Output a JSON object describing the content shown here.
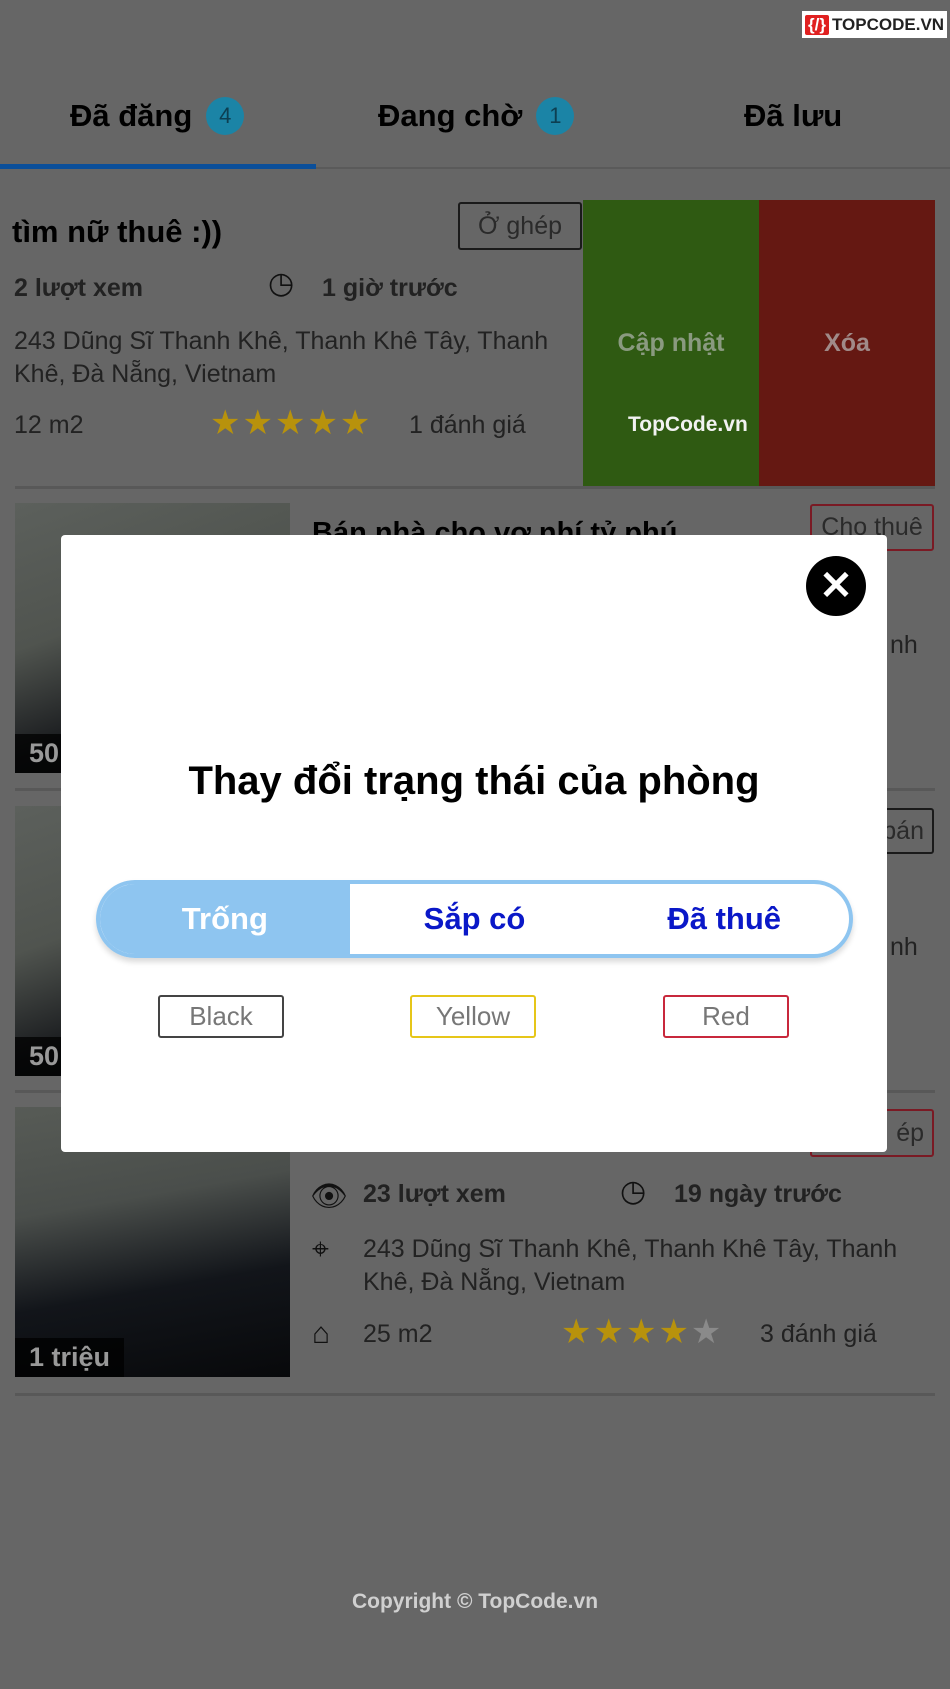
{
  "logo": "TOPCODE.VN",
  "tabs": [
    {
      "label": "Đã đăng",
      "count": "4",
      "active": true
    },
    {
      "label": "Đang chờ",
      "count": "1"
    },
    {
      "label": "Đã lưu"
    }
  ],
  "colors": {
    "accent": "#1565c0",
    "update": "#75e12d",
    "delete": "#fc3c2d",
    "star": "#f0b800"
  },
  "cards": [
    {
      "title": "tìm nữ thuê :))",
      "type": "Ở ghép",
      "views": "2 lượt xem",
      "time": "1 giờ trước",
      "address1": "243 Dũng Sĩ Thanh Khê, Thanh Khê Tây, Thanh",
      "address2": "Khê, Đà Nẵng, Vietnam",
      "area": "12  m2",
      "rating": 5,
      "reviews": "1 đánh giá",
      "actions": {
        "update": "Cập nhật",
        "delete": "Xóa"
      },
      "watermark": "TopCode.vn"
    },
    {
      "title": "Bán nhà cho vợ nhí tỷ phú",
      "type": "Cho thuê",
      "price": "50",
      "partial": "nh"
    },
    {
      "type": "bán",
      "price": "50",
      "partial": "nh"
    },
    {
      "type": "ép",
      "views": "23 lượt xem",
      "time": "19 ngày trước",
      "address1": "243 Dũng Sĩ Thanh Khê, Thanh Khê Tây, Thanh",
      "address2": "Khê, Đà Nẵng, Vietnam",
      "area": "25  m2",
      "rating": 4,
      "reviews": "3 đánh giá",
      "price": "1 triệu"
    }
  ],
  "footer": "Copyright © TopCode.vn",
  "modal": {
    "title": "Thay đổi trạng thái của phòng",
    "segments": [
      "Trống",
      "Sắp có",
      "Đã thuê"
    ],
    "selected": "Trống",
    "colors": [
      {
        "label": "Black",
        "color": "#444444"
      },
      {
        "label": "Yellow",
        "color": "#e6c619"
      },
      {
        "label": "Red",
        "color": "#c8283c"
      }
    ]
  }
}
